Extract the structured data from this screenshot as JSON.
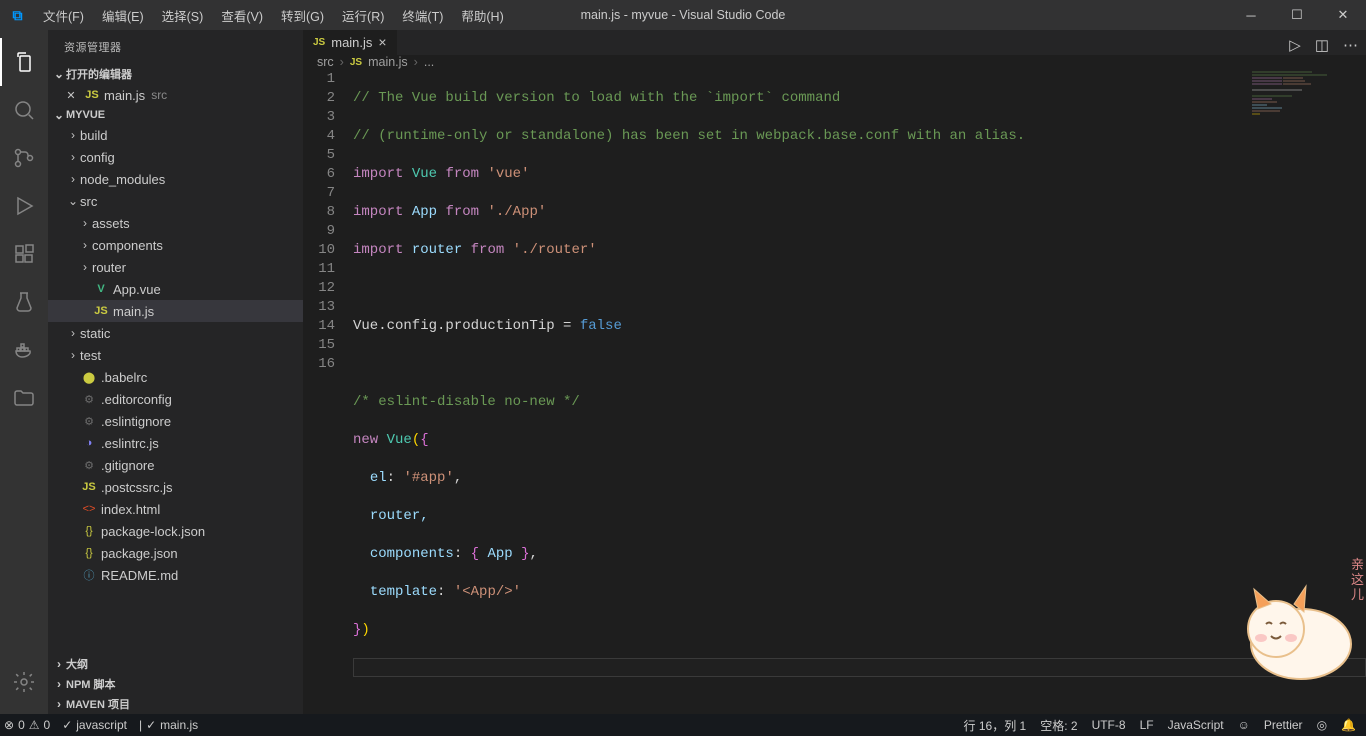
{
  "titlebar": {
    "title": "main.js - myvue - Visual Studio Code"
  },
  "menu": {
    "file": "文件(F)",
    "edit": "编辑(E)",
    "select": "选择(S)",
    "view": "查看(V)",
    "go": "转到(G)",
    "run": "运行(R)",
    "terminal": "终端(T)",
    "help": "帮助(H)"
  },
  "sidebar": {
    "title": "资源管理器",
    "openEditors": {
      "label": "打开的编辑器",
      "items": [
        {
          "name": "main.js",
          "path": "src"
        }
      ]
    },
    "project": {
      "name": "MYVUE",
      "tree": [
        {
          "type": "folder",
          "name": "build",
          "depth": 0,
          "open": false
        },
        {
          "type": "folder",
          "name": "config",
          "depth": 0,
          "open": false
        },
        {
          "type": "folder",
          "name": "node_modules",
          "depth": 0,
          "open": false
        },
        {
          "type": "folder",
          "name": "src",
          "depth": 0,
          "open": true
        },
        {
          "type": "folder",
          "name": "assets",
          "depth": 1,
          "open": false
        },
        {
          "type": "folder",
          "name": "components",
          "depth": 1,
          "open": false
        },
        {
          "type": "folder",
          "name": "router",
          "depth": 1,
          "open": false
        },
        {
          "type": "file",
          "name": "App.vue",
          "depth": 1,
          "icon": "vue"
        },
        {
          "type": "file",
          "name": "main.js",
          "depth": 1,
          "icon": "js",
          "selected": true
        },
        {
          "type": "folder",
          "name": "static",
          "depth": 0,
          "open": false
        },
        {
          "type": "folder",
          "name": "test",
          "depth": 0,
          "open": false
        },
        {
          "type": "file",
          "name": ".babelrc",
          "depth": 0,
          "icon": "gear-y"
        },
        {
          "type": "file",
          "name": ".editorconfig",
          "depth": 0,
          "icon": "gear"
        },
        {
          "type": "file",
          "name": ".eslintignore",
          "depth": 0,
          "icon": "gear"
        },
        {
          "type": "file",
          "name": ".eslintrc.js",
          "depth": 0,
          "icon": "eslint"
        },
        {
          "type": "file",
          "name": ".gitignore",
          "depth": 0,
          "icon": "gear"
        },
        {
          "type": "file",
          "name": ".postcssrc.js",
          "depth": 0,
          "icon": "js"
        },
        {
          "type": "file",
          "name": "index.html",
          "depth": 0,
          "icon": "html"
        },
        {
          "type": "file",
          "name": "package-lock.json",
          "depth": 0,
          "icon": "json"
        },
        {
          "type": "file",
          "name": "package.json",
          "depth": 0,
          "icon": "json"
        },
        {
          "type": "file",
          "name": "README.md",
          "depth": 0,
          "icon": "info"
        }
      ]
    },
    "outline": "大纲",
    "npm": "NPM 脚本",
    "maven": "MAVEN 项目"
  },
  "tab": {
    "name": "main.js"
  },
  "breadcrumb": {
    "p1": "src",
    "p2": "main.js",
    "p3": "..."
  },
  "code": {
    "l1": "// The Vue build version to load with the `import` command",
    "l2a": "// (",
    "l2b": "runtime-only or standalone",
    "l2c": ") has been set in webpack.base.conf with an alias.",
    "l3_import": "import",
    "l3_vue": "Vue",
    "l3_from": "from",
    "l3_str": "'vue'",
    "l4_import": "import",
    "l4_app": "App",
    "l4_from": "from",
    "l4_str": "'./App'",
    "l5_import": "import",
    "l5_router": "router",
    "l5_from": "from",
    "l5_str": "'./router'",
    "l7": "Vue.config.productionTip = ",
    "l7_false": "false",
    "l9": "/* eslint-disable no-new */",
    "l10_new": "new",
    "l10_vue": "Vue",
    "l10_p": "({",
    "l11_el": "el",
    "l11_s": "'#app'",
    "l12": "router,",
    "l13_c": "components",
    "l13_app": "App",
    "l14_t": "template",
    "l14_s": "'<App/>'",
    "l15": "})"
  },
  "status": {
    "errors": "0",
    "warnings": "0",
    "lang_left": "javascript",
    "file_left": "main.js",
    "cursor": "行 16，列 1",
    "spaces": "空格: 2",
    "encoding": "UTF-8",
    "eol": "LF",
    "language": "JavaScript",
    "prettier": "Prettier"
  }
}
